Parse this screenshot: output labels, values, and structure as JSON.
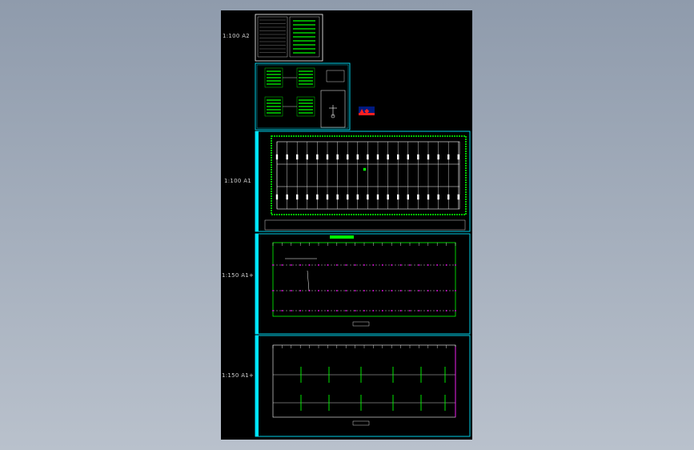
{
  "viewport": {
    "background_top": "#8f9bac",
    "background_bottom": "#b9c1cc",
    "canvas_color": "#000000"
  },
  "sheets": [
    {
      "id": "sheet-1",
      "scale_label": "1:100  A2",
      "content": "legend-tables"
    },
    {
      "id": "sheet-2",
      "scale_label": "",
      "content": "system-diagram"
    },
    {
      "id": "sheet-3",
      "scale_label": "1:100  A1",
      "content": "floor-plan-layout"
    },
    {
      "id": "sheet-4",
      "scale_label": "1:150  A1+",
      "content": "lighting-plan"
    },
    {
      "id": "sheet-5",
      "scale_label": "1:150  A1+",
      "content": "power-plan"
    }
  ],
  "colors": {
    "frame": "#00e5ff",
    "linework": "#00ff00",
    "white": "#ffffff",
    "magenta": "#ff00ff",
    "red": "#ff2020",
    "blue": "#3050ff"
  },
  "logo": {
    "name": "cad-logo-icon"
  }
}
